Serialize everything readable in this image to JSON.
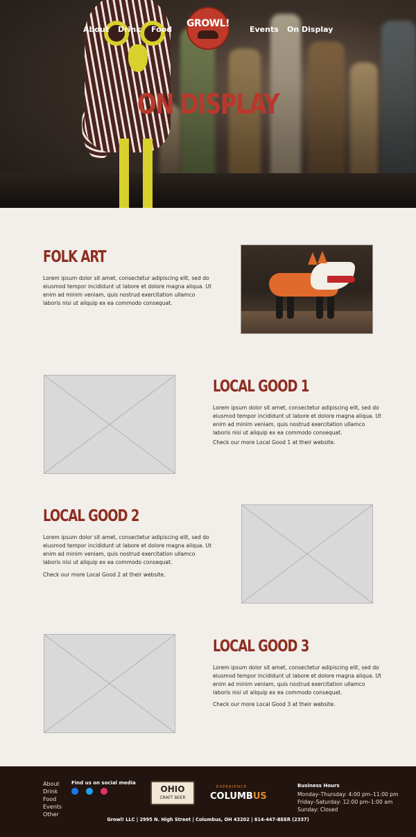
{
  "nav": {
    "about": "About",
    "drink": "Drink",
    "food": "Food",
    "logo_text": "GROWL!",
    "events": "Events",
    "on_display": "On Display"
  },
  "hero": {
    "title": "ON DISPLAY"
  },
  "sections": [
    {
      "title": "FOLK ART",
      "body": "Lorem ipsum dolor sit amet, consectetur adipiscing elit, sed do eiusmod tempor incididunt ut labore et dolore magna aliqua. Ut enim ad minim veniam, quis nostrud exercitation ullamco laboris nisi ut aliquip ex ea commodo consequat."
    },
    {
      "title": "LOCAL GOOD 1",
      "body": "Lorem ipsum dolor sit amet, consectetur adipiscing elit, sed do eiusmod tempor incididunt ut labore et dolore magna aliqua. Ut enim ad minim veniam, quis nostrud exercitation ullamco laboris nisi ut aliquip ex ea commodo consequat.",
      "link": "Check our more Local Good 1 at their website."
    },
    {
      "title": "LOCAL GOOD 2",
      "body": "Lorem ipsum dolor sit amet, consectetur adipiscing elit, sed do eiusmod tempor incididunt ut labore et dolore magna aliqua. Ut enim ad minim veniam, quis nostrud exercitation ullamco laboris nisi ut aliquip ex ea commodo consequat.",
      "link": "Check our more Local Good 2 at their website."
    },
    {
      "title": "LOCAL GOOD 3",
      "body": "Lorem ipsum dolor sit amet, consectetur adipiscing elit, sed do eiusmod tempor incididunt ut labore et dolore magna aliqua. Ut enim ad minim veniam, quis nostrud exercitation ullamco laboris nisi ut aliquip ex ea commodo consequat.",
      "link": "Check our more Local Good 3 at their website."
    }
  ],
  "footer": {
    "links": [
      "About",
      "Drink",
      "Food",
      "Events",
      "Other"
    ],
    "social_heading": "Find us on social media",
    "social_icons": [
      "facebook-icon",
      "twitter-icon",
      "instagram-icon"
    ],
    "ohio_logo": {
      "top": "OHIO",
      "bottom": "CRAFT BEER"
    },
    "columbus_logo": {
      "small": "EXPERIENCE",
      "big_start": "COLUMB",
      "big_highlight": "US"
    },
    "hours_heading": "Business Hours",
    "hours": [
      "Monday–Thursday: 4:00 pm–11:00 pm",
      "Friday–Saturday: 12:00 pm–1:00 am",
      "Sunday: Closed"
    ],
    "address": "Growl! LLC | 2995 N. High Street | Columbus, OH 43202 | 614-447-BEER (2337)"
  },
  "colors": {
    "accent": "#8e2d21",
    "hero_title": "#b8392c",
    "page_bg": "#f2efea",
    "footer_bg": "#22140f"
  }
}
